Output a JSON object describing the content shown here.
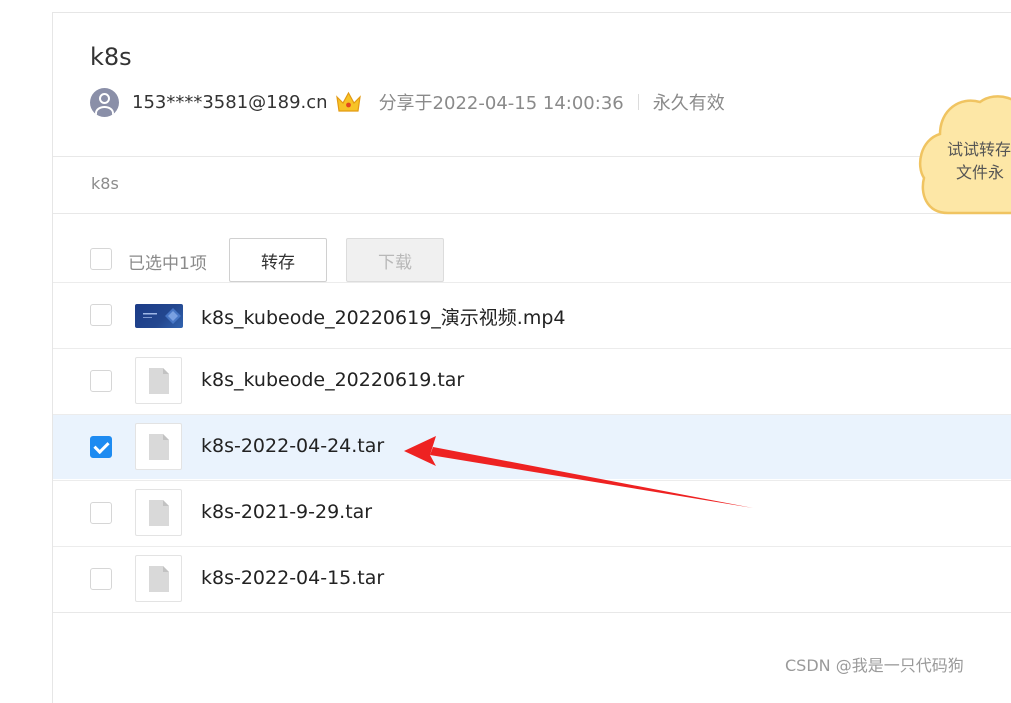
{
  "share": {
    "title": "k8s",
    "user": "153****3581@189.cn",
    "vip_icon": "crown-icon",
    "share_time": "分享于2022-04-15 14:00:36",
    "expiry": "永久有效"
  },
  "breadcrumb": "k8s",
  "toolbar": {
    "selected_label": "已选中1项",
    "save_label": "转存",
    "download_label": "下载"
  },
  "files": [
    {
      "name": "k8s_kubeode_20220619_演示视频.mp4",
      "type": "video",
      "checked": false
    },
    {
      "name": "k8s_kubeode_20220619.tar",
      "type": "file",
      "checked": false
    },
    {
      "name": "k8s-2022-04-24.tar",
      "type": "file",
      "checked": true
    },
    {
      "name": "k8s-2021-9-29.tar",
      "type": "file",
      "checked": false
    },
    {
      "name": "k8s-2022-04-15.tar",
      "type": "file",
      "checked": false
    }
  ],
  "promo": {
    "line1": "试试转存",
    "line2": "文件永"
  },
  "annotation": {
    "color": "#ee2222"
  },
  "colors": {
    "accent": "#1e8bf1",
    "selected_row": "#eaf3fd",
    "cloud": "#fde7a6"
  },
  "watermark": "CSDN @我是一只代码狗"
}
